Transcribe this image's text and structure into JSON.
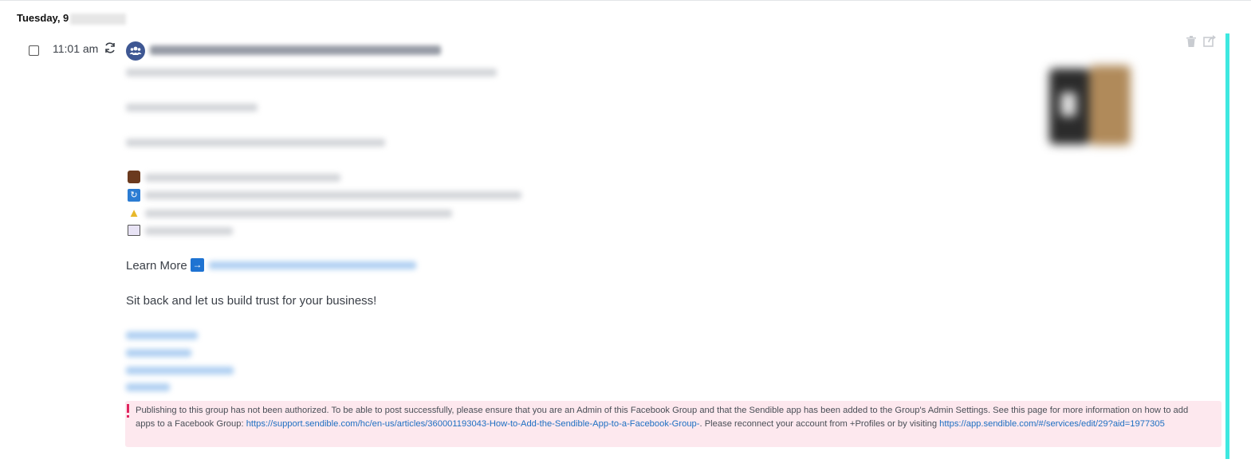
{
  "date_header": {
    "label": "Tuesday, 9"
  },
  "post": {
    "time": "11:01 am",
    "learn_more_label": "Learn More",
    "closing_line": "Sit back and let us build trust for your business!",
    "icons": {
      "recurring": "refresh-icon",
      "group": "group-icon",
      "delete": "trash-icon",
      "share": "share-icon",
      "learn_more_arrow": "right-arrow-icon"
    },
    "emoji_list": [
      "briefcase-icon",
      "sync-icon",
      "thumbs-up-icon",
      "film-icon"
    ]
  },
  "error": {
    "text_1": "Publishing to this group has not been authorized. To be able to post successfully, please ensure that you are an Admin of this Facebook Group and that the Sendible app has been added to the Group's Admin Settings. See this page for more information on how to add apps to a Facebook Group: ",
    "link_1": "https://support.sendible.com/hc/en-us/articles/360001193043-How-to-Add-the-Sendible-App-to-a-Facebook-Group-",
    "text_2": ". Please reconnect your account from +Profiles or by visiting ",
    "link_2": "https://app.sendible.com/#/services/edit/29?aid=1977305"
  },
  "colors": {
    "accent_bar": "#3ee8e0",
    "error_bg": "#fde8ee",
    "error_mark": "#e0245e",
    "link": "#1d6fc2",
    "group_avatar": "#3e5793"
  }
}
